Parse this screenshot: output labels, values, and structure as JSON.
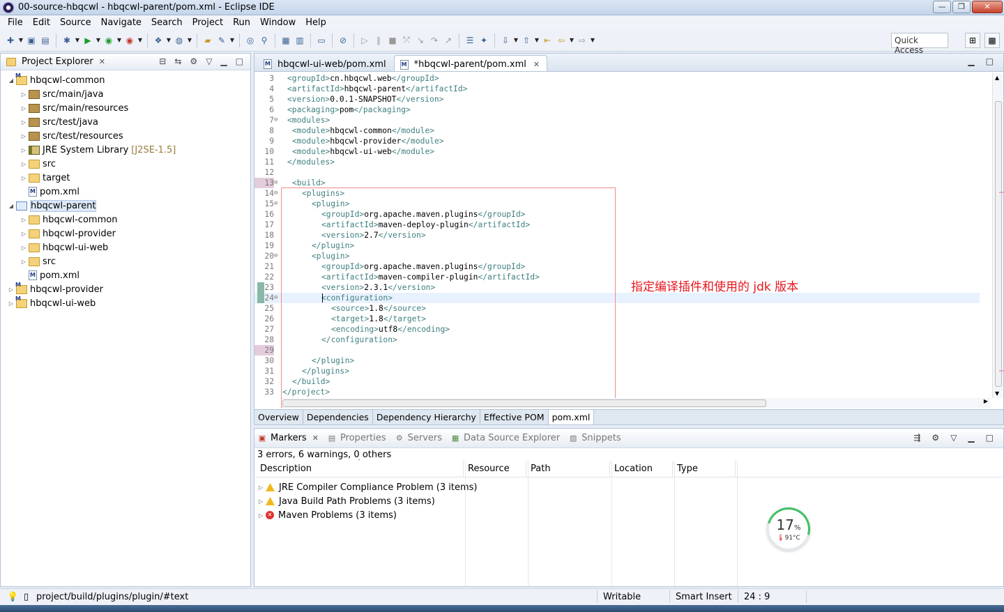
{
  "window": {
    "title": "00-source-hbqcwl - hbqcwl-parent/pom.xml - Eclipse IDE",
    "buttons": {
      "minimize": "—",
      "maximize": "❐",
      "close": "✕"
    }
  },
  "menu": [
    "File",
    "Edit",
    "Source",
    "Navigate",
    "Search",
    "Project",
    "Run",
    "Window",
    "Help"
  ],
  "quick_access": "Quick Access",
  "project_explorer": {
    "title": "Project Explorer",
    "tree": [
      {
        "label": "hbqcwl-common",
        "level": 0,
        "icon": "proj",
        "expanded": true
      },
      {
        "label": "src/main/java",
        "level": 1,
        "icon": "pkg"
      },
      {
        "label": "src/main/resources",
        "level": 1,
        "icon": "pkg"
      },
      {
        "label": "src/test/java",
        "level": 1,
        "icon": "pkg"
      },
      {
        "label": "src/test/resources",
        "level": 1,
        "icon": "pkg"
      },
      {
        "label": "JRE System Library",
        "suffix": "[J2SE-1.5]",
        "level": 1,
        "icon": "lib"
      },
      {
        "label": "src",
        "level": 1,
        "icon": "folder"
      },
      {
        "label": "target",
        "level": 1,
        "icon": "folder"
      },
      {
        "label": "pom.xml",
        "level": 1,
        "icon": "xml",
        "leaf": true
      },
      {
        "label": "hbqcwl-parent",
        "level": 0,
        "icon": "projsel",
        "expanded": true,
        "selected": true
      },
      {
        "label": "hbqcwl-common",
        "level": 1,
        "icon": "folder"
      },
      {
        "label": "hbqcwl-provider",
        "level": 1,
        "icon": "folder"
      },
      {
        "label": "hbqcwl-ui-web",
        "level": 1,
        "icon": "folder"
      },
      {
        "label": "src",
        "level": 1,
        "icon": "folder"
      },
      {
        "label": "pom.xml",
        "level": 1,
        "icon": "xml",
        "leaf": true
      },
      {
        "label": "hbqcwl-provider",
        "level": 0,
        "icon": "proj"
      },
      {
        "label": "hbqcwl-ui-web",
        "level": 0,
        "icon": "proj"
      }
    ]
  },
  "editor": {
    "tabs": [
      {
        "label": "hbqcwl-ui-web/pom.xml",
        "active": false
      },
      {
        "label": "*hbqcwl-parent/pom.xml",
        "active": true
      }
    ],
    "lines": [
      {
        "n": "3",
        "indent": 1,
        "tag": "groupId",
        "text": "cn.hbqcwl.web"
      },
      {
        "n": "4",
        "indent": 1,
        "tag": "artifactId",
        "text": "hbqcwl-parent"
      },
      {
        "n": "5",
        "indent": 1,
        "tag": "version",
        "text": "0.0.1-SNAPSHOT"
      },
      {
        "n": "6",
        "indent": 1,
        "tag": "packaging",
        "text": "pom"
      },
      {
        "n": "7",
        "indent": 1,
        "open": "modules",
        "fold": true
      },
      {
        "n": "8",
        "indent": 2,
        "tag": "module",
        "text": "hbqcwl-common"
      },
      {
        "n": "9",
        "indent": 2,
        "tag": "module",
        "text": "hbqcwl-provider"
      },
      {
        "n": "10",
        "indent": 2,
        "tag": "module",
        "text": "hbqcwl-ui-web"
      },
      {
        "n": "11",
        "indent": 1,
        "close": "modules"
      },
      {
        "n": "12",
        "indent": 0
      },
      {
        "n": "13",
        "indent": 2,
        "open": "build",
        "fold": true,
        "hl": true
      },
      {
        "n": "14",
        "indent": 4,
        "open": "plugins",
        "fold": true
      },
      {
        "n": "15",
        "indent": 6,
        "open": "plugin",
        "fold": true
      },
      {
        "n": "16",
        "indent": 8,
        "tag": "groupId",
        "text": "org.apache.maven.plugins"
      },
      {
        "n": "17",
        "indent": 8,
        "tag": "artifactId",
        "text": "maven-deploy-plugin"
      },
      {
        "n": "18",
        "indent": 8,
        "tag": "version",
        "text": "2.7"
      },
      {
        "n": "19",
        "indent": 6,
        "close": "plugin"
      },
      {
        "n": "20",
        "indent": 6,
        "open": "plugin",
        "fold": true
      },
      {
        "n": "21",
        "indent": 8,
        "tag": "groupId",
        "text": "org.apache.maven.plugins"
      },
      {
        "n": "22",
        "indent": 8,
        "tag": "artifactId",
        "text": "maven-compiler-plugin"
      },
      {
        "n": "23",
        "indent": 8,
        "tag": "version",
        "text": "2.3.1",
        "changed": true
      },
      {
        "n": "24",
        "indent": 8,
        "open": "configuration",
        "fold": true,
        "current": true,
        "changed": true
      },
      {
        "n": "25",
        "indent": 10,
        "tag": "source",
        "text": "1.8"
      },
      {
        "n": "26",
        "indent": 10,
        "tag": "target",
        "text": "1.8"
      },
      {
        "n": "27",
        "indent": 10,
        "tag": "encoding",
        "text": "utf8"
      },
      {
        "n": "28",
        "indent": 8,
        "close": "configuration"
      },
      {
        "n": "29",
        "indent": 0,
        "hl": true
      },
      {
        "n": "30",
        "indent": 6,
        "close": "plugin"
      },
      {
        "n": "31",
        "indent": 4,
        "close": "plugins"
      },
      {
        "n": "32",
        "indent": 2,
        "close": "build"
      },
      {
        "n": "33",
        "indent": 0,
        "close": "project"
      }
    ],
    "annotation": "指定编译插件和使用的 jdk 版本",
    "pom_tabs": [
      "Overview",
      "Dependencies",
      "Dependency Hierarchy",
      "Effective POM",
      "pom.xml"
    ]
  },
  "markers": {
    "tabs": [
      "Markers",
      "Properties",
      "Servers",
      "Data Source Explorer",
      "Snippets"
    ],
    "summary": "3 errors, 6 warnings, 0 others",
    "columns": [
      "Description",
      "Resource",
      "Path",
      "Location",
      "Type"
    ],
    "rows": [
      {
        "label": "JRE Compiler Compliance Problem (3 items)",
        "severity": "warning"
      },
      {
        "label": "Java Build Path Problems (3 items)",
        "severity": "warning"
      },
      {
        "label": "Maven Problems (3 items)",
        "severity": "error"
      }
    ]
  },
  "gauge": {
    "percent": "17",
    "unit": "%",
    "temp": "91°C",
    "fraction": 0.17
  },
  "status": {
    "path": "project/build/plugins/plugin/#text",
    "writable": "Writable",
    "insert": "Smart Insert",
    "position": "24 : 9"
  },
  "colors": {
    "annotation": "#e5161e",
    "tag": "#3f7f7f",
    "box": "#f08a8a"
  }
}
